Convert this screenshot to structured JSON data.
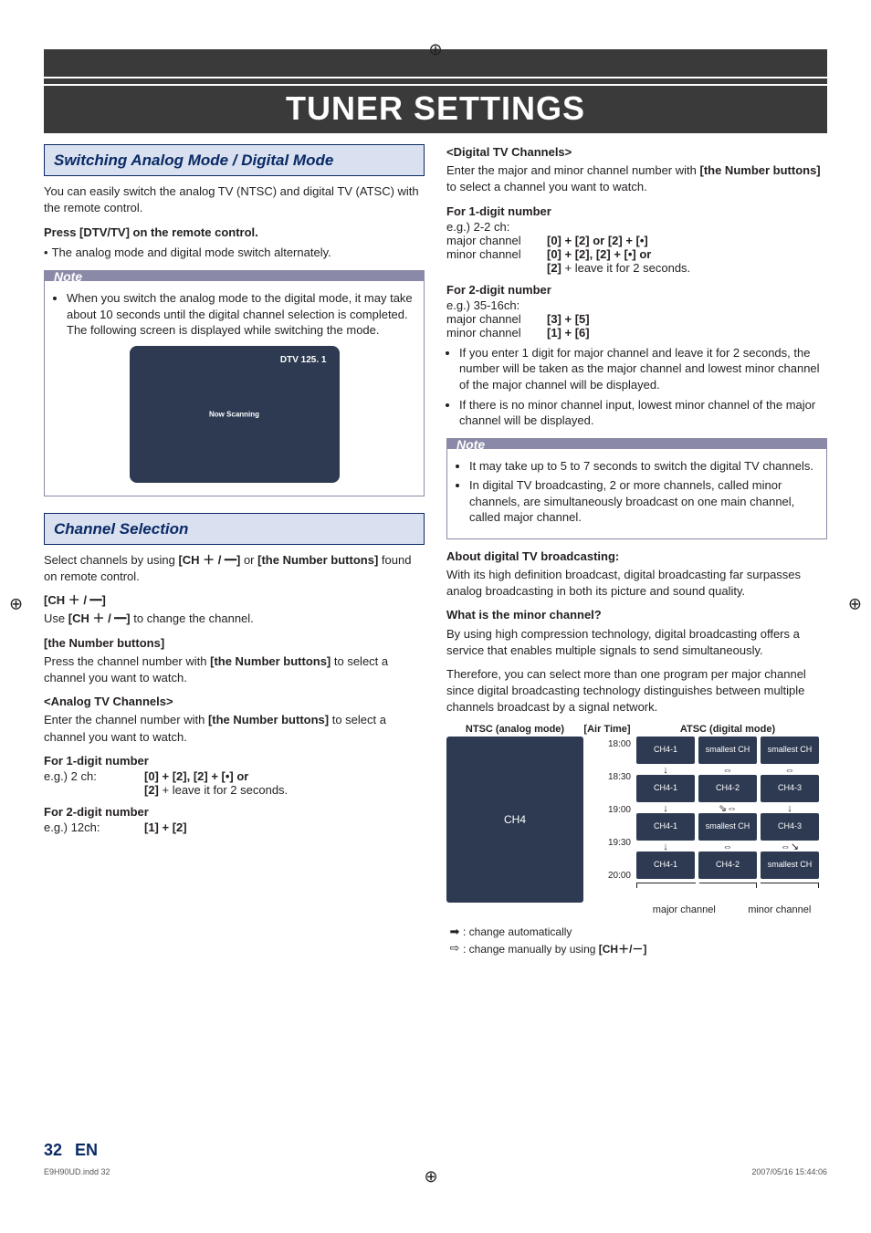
{
  "bannerTitle": "TUNER SETTINGS",
  "left": {
    "section1": {
      "title": "Switching Analog Mode / Digital Mode",
      "intro": "You can easily switch the analog TV (NTSC) and digital TV (ATSC) with the remote control.",
      "pressLine": "Press [DTV/TV] on the remote control.",
      "pressBullet": "The analog mode and digital mode switch alternately.",
      "noteLabel": "Note",
      "noteItem": "When you switch the analog mode to the digital mode, it may take about 10 seconds until the digital channel selection is completed. The following screen is displayed while switching the mode.",
      "tvCorner": "DTV 125. 1",
      "tvCenter": "Now Scanning"
    },
    "section2": {
      "title": "Channel Selection",
      "introPrefix": "Select channels by using ",
      "introKeys1": "[CH ＋ / ━]",
      "introMid": " or ",
      "introKeys2": "[the Number buttons]",
      "introSuffix": " found on remote control.",
      "chHead": "[CH ＋ / ━]",
      "chLinePrefix": "Use ",
      "chLineKeys": "[CH ＋ / ━]",
      "chLineSuffix": " to change the channel.",
      "nbHead": "[the Number buttons]",
      "nbLinePrefix": "Press the channel number with ",
      "nbLineKeys": "[the Number buttons]",
      "nbLineSuffix": " to select a channel you want to watch.",
      "analogHead": "<Analog TV Channels>",
      "analogLinePrefix": "Enter the channel number with ",
      "analogLineKeys": "[the Number buttons]",
      "analogLineSuffix": " to select a channel you want to watch.",
      "for1": "For 1-digit number",
      "eg1k": "e.g.) 2 ch:",
      "eg1v1": "[0] + [2], [2] + [•] or",
      "eg1v2": "[2] + leave it for 2 seconds.",
      "for2": "For 2-digit number",
      "eg2k": "e.g.) 12ch:",
      "eg2v": "[1] + [2]"
    }
  },
  "right": {
    "digHead": "<Digital TV Channels>",
    "digIntroPrefix": "Enter the major and minor channel number with ",
    "digIntroKeys": "[the Number buttons]",
    "digIntroSuffix": " to select a channel you want to watch.",
    "for1": "For 1-digit number",
    "eg1": "e.g.) 2-2 ch:",
    "major": "major channel",
    "minor": "minor channel",
    "majV1": "[0] + [2] or [2] + [•]",
    "minV1a": "[0] + [2], [2] + [•] or",
    "minV1b": "[2] + leave it for 2 seconds.",
    "for2": "For 2-digit number",
    "eg2": "e.g.) 35-16ch:",
    "majV2": "[3] + [5]",
    "minV2": "[1] + [6]",
    "b1": "If you enter 1 digit for major channel and leave it for 2 seconds, the number will be taken as the major channel and lowest minor channel of the major channel will be displayed.",
    "b2": "If there is no minor channel input, lowest minor channel of the major channel will be displayed.",
    "noteLabel": "Note",
    "n1": "It may take up to 5 to 7 seconds to switch the digital TV channels.",
    "n2": "In digital TV broadcasting, 2 or more channels, called minor channels, are simultaneously broadcast on one main channel, called major channel.",
    "aboutHead": "About digital TV broadcasting:",
    "aboutBody": "With its high definition broadcast, digital broadcasting far surpasses analog broadcasting in both its picture and sound quality.",
    "whatHead": "What is the minor channel?",
    "whatBody1": "By using high compression technology, digital broadcasting offers a service that enables multiple signals to send simultaneously.",
    "whatBody2": "Therefore, you can select more than one program per major channel since digital broadcasting technology distinguishes between multiple channels broadcast by a signal network.",
    "diagram": {
      "ntscHead": "NTSC (analog mode)",
      "airTimeHead": "[Air Time]",
      "atscHead": "ATSC (digital mode)",
      "times": [
        "18:00",
        "18:30",
        "19:00",
        "19:30",
        "20:00"
      ],
      "ntscLabel": "CH4",
      "ch41": "CH4-1",
      "ch42": "CH4-2",
      "ch43": "CH4-3",
      "smallest": "smallest CH",
      "capMajor": "major channel",
      "capMinor": "minor channel"
    },
    "legend": {
      "auto": ": change automatically",
      "manualPrefix": ": change manually by using ",
      "manualKeys": "[CH＋/－]"
    }
  },
  "footer": {
    "pageNum": "32",
    "en": "EN",
    "file": "E9H90UD.indd   32",
    "date": "2007/05/16   15:44:06"
  }
}
